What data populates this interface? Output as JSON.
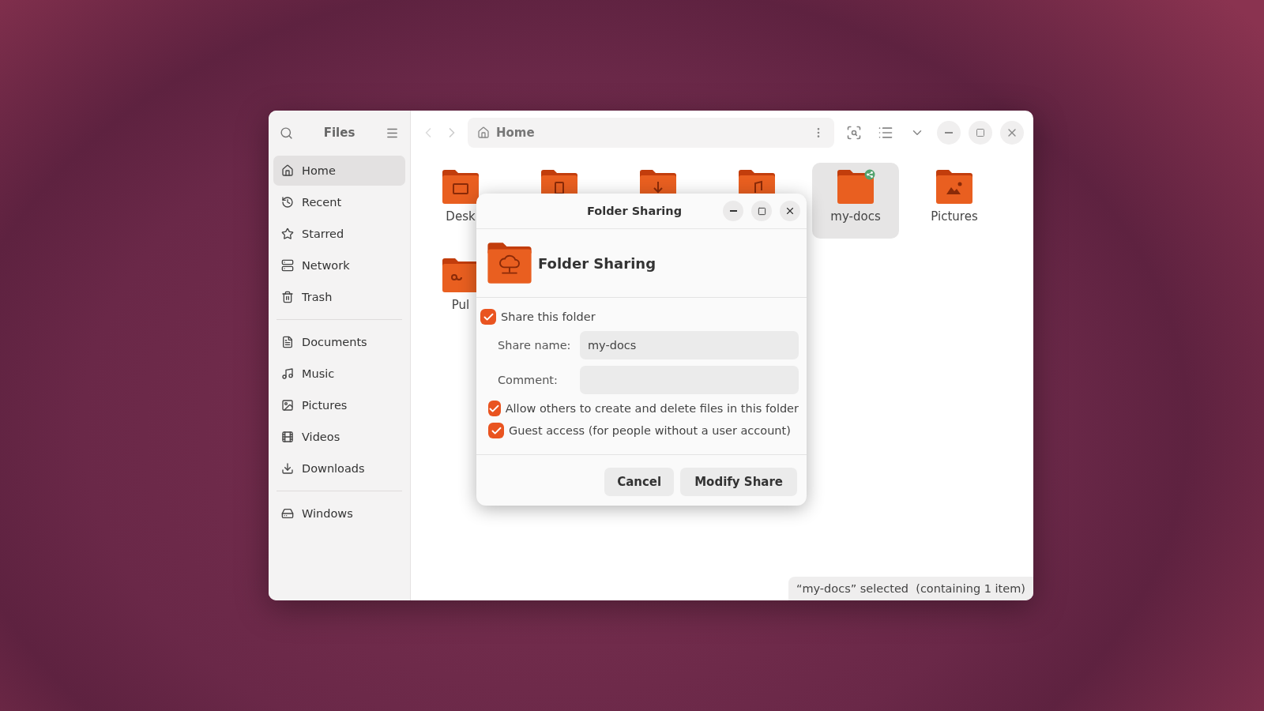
{
  "sidebar": {
    "title": "Files",
    "groups": [
      [
        {
          "label": "Home",
          "selected": true
        },
        {
          "label": "Recent",
          "selected": false
        },
        {
          "label": "Starred",
          "selected": false
        },
        {
          "label": "Network",
          "selected": false
        },
        {
          "label": "Trash",
          "selected": false
        }
      ],
      [
        {
          "label": "Documents",
          "selected": false
        },
        {
          "label": "Music",
          "selected": false
        },
        {
          "label": "Pictures",
          "selected": false
        },
        {
          "label": "Videos",
          "selected": false
        },
        {
          "label": "Downloads",
          "selected": false
        }
      ],
      [
        {
          "label": "Windows",
          "selected": false
        }
      ]
    ]
  },
  "path_bar": {
    "location": "Home"
  },
  "folders": [
    {
      "label": "Desk",
      "selected": false,
      "shared": false
    },
    {
      "selected": false,
      "shared": false
    },
    {
      "selected": false,
      "shared": false
    },
    {
      "selected": false,
      "shared": false
    },
    {
      "label": "my-docs",
      "selected": true,
      "shared": true
    },
    {
      "label": "Pictures",
      "selected": false,
      "shared": false
    },
    {
      "label": "Pul",
      "selected": false,
      "shared": false
    }
  ],
  "dialog": {
    "title": "Folder Sharing",
    "heading": "Folder Sharing",
    "share": {
      "label": "Share this folder",
      "checked": true
    },
    "fields": [
      {
        "label": "Share name:",
        "value": "my-docs"
      },
      {
        "label": "Comment:"
      }
    ],
    "options": [
      {
        "label": "Allow others to create and delete files in this folder",
        "checked": true
      },
      {
        "label": "Guest access (for people without a user account)",
        "checked": true
      }
    ],
    "buttons": [
      {
        "label": "Cancel",
        "kind": "secondary"
      },
      {
        "label": "Modify Share",
        "kind": "primary"
      }
    ]
  },
  "status_bar": "“my-docs” selected  (containing 1 item)"
}
